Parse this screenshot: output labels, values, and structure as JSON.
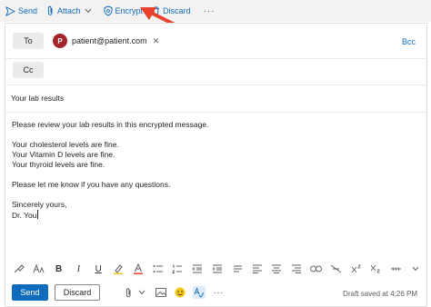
{
  "toolbar": {
    "send_label": "Send",
    "attach_label": "Attach",
    "encrypt_label": "Encrypt",
    "discard_label": "Discard",
    "more_label": "···"
  },
  "header": {
    "to_label": "To",
    "cc_label": "Cc",
    "bcc_label": "Bcc",
    "recipient": {
      "initial": "P",
      "email": "patient@patient.com",
      "avatar_color": "#a4262c"
    }
  },
  "subject": "Your lab results",
  "body": {
    "line1": "Please review your lab results in this encrypted message.",
    "line2": "Your cholesterol levels are fine.",
    "line3": "Your Vitamin D levels are fine.",
    "line4": "Your thyroid levels are fine.",
    "line5": "Please let me know if you have any questions.",
    "line6": "Sincerely yours,",
    "line7": "Dr. You"
  },
  "bottom": {
    "send_label": "Send",
    "discard_label": "Discard",
    "more_label": "···",
    "draft_status": "Draft saved at 4:26 PM"
  },
  "colors": {
    "accent": "#0f6cbd",
    "arrow": "#e8412c",
    "toolbar_bg": "#f3f2f1"
  }
}
